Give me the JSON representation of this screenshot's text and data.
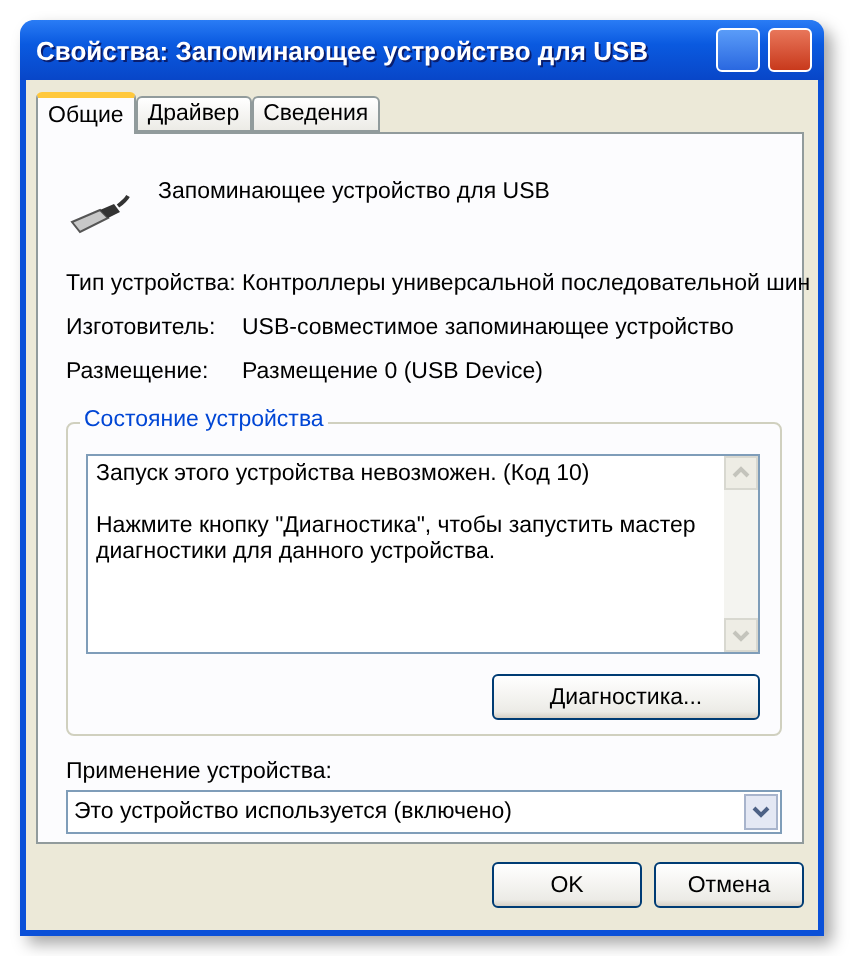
{
  "window": {
    "title": "Свойства: Запоминающее устройство для USB"
  },
  "tabs": [
    {
      "label": "Общие",
      "selected": true
    },
    {
      "label": "Драйвер",
      "selected": false
    },
    {
      "label": "Сведения",
      "selected": false
    }
  ],
  "device": {
    "name": "Запоминающее устройство для USB"
  },
  "properties": [
    {
      "label": "Тип устройства:",
      "value": "Контроллеры универсальной последовательной шин"
    },
    {
      "label": "Изготовитель:",
      "value": "USB-совместимое запоминающее устройство"
    },
    {
      "label": "Размещение:",
      "value": "Размещение 0 (USB Device)"
    }
  ],
  "status_group": {
    "title": "Состояние устройства",
    "lines": [
      "Запуск этого устройства невозможен. (Код 10)",
      "Нажмите кнопку \"Диагностика\", чтобы запустить мастер диагностики для данного устройства."
    ],
    "button": "Диагностика..."
  },
  "usage": {
    "label": "Применение устройства:",
    "value": "Это устройство используется (включено)"
  },
  "buttons": [
    "OK",
    "Отмена"
  ]
}
